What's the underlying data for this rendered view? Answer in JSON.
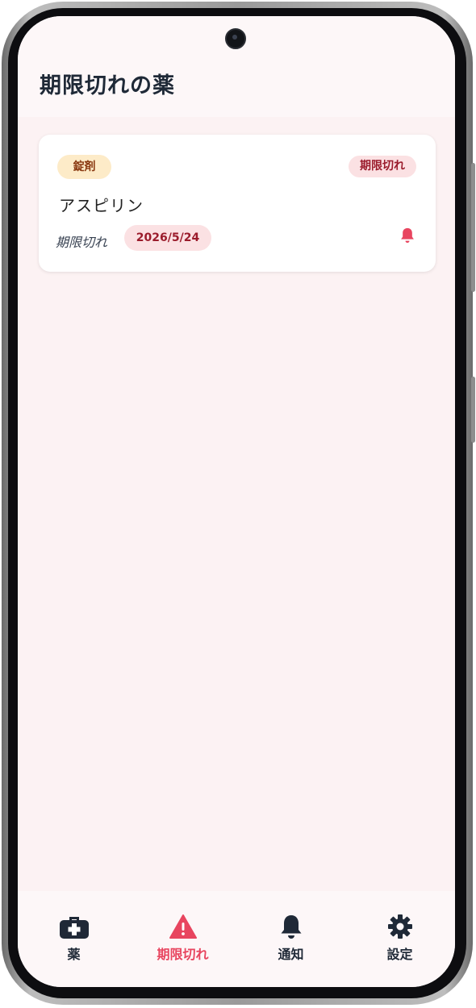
{
  "header": {
    "title": "期限切れの薬"
  },
  "medications": [
    {
      "type": "錠剤",
      "status": "期限切れ",
      "name": "アスピリン",
      "expiry_label": "期限切れ",
      "expiry_date": "2026/5/24",
      "alert_icon": "bell-icon"
    }
  ],
  "tabs": [
    {
      "label": "薬",
      "icon": "medkit-icon",
      "active": false
    },
    {
      "label": "期限切れ",
      "icon": "warning-icon",
      "active": true
    },
    {
      "label": "通知",
      "icon": "bell-icon",
      "active": false
    },
    {
      "label": "設定",
      "icon": "gear-icon",
      "active": false
    }
  ],
  "colors": {
    "accent": "#e8455f",
    "text_dark": "#1f2937",
    "background": "#fcf2f3",
    "badge_type_bg": "#fdebc8",
    "badge_status_bg": "#fbe1e3"
  }
}
